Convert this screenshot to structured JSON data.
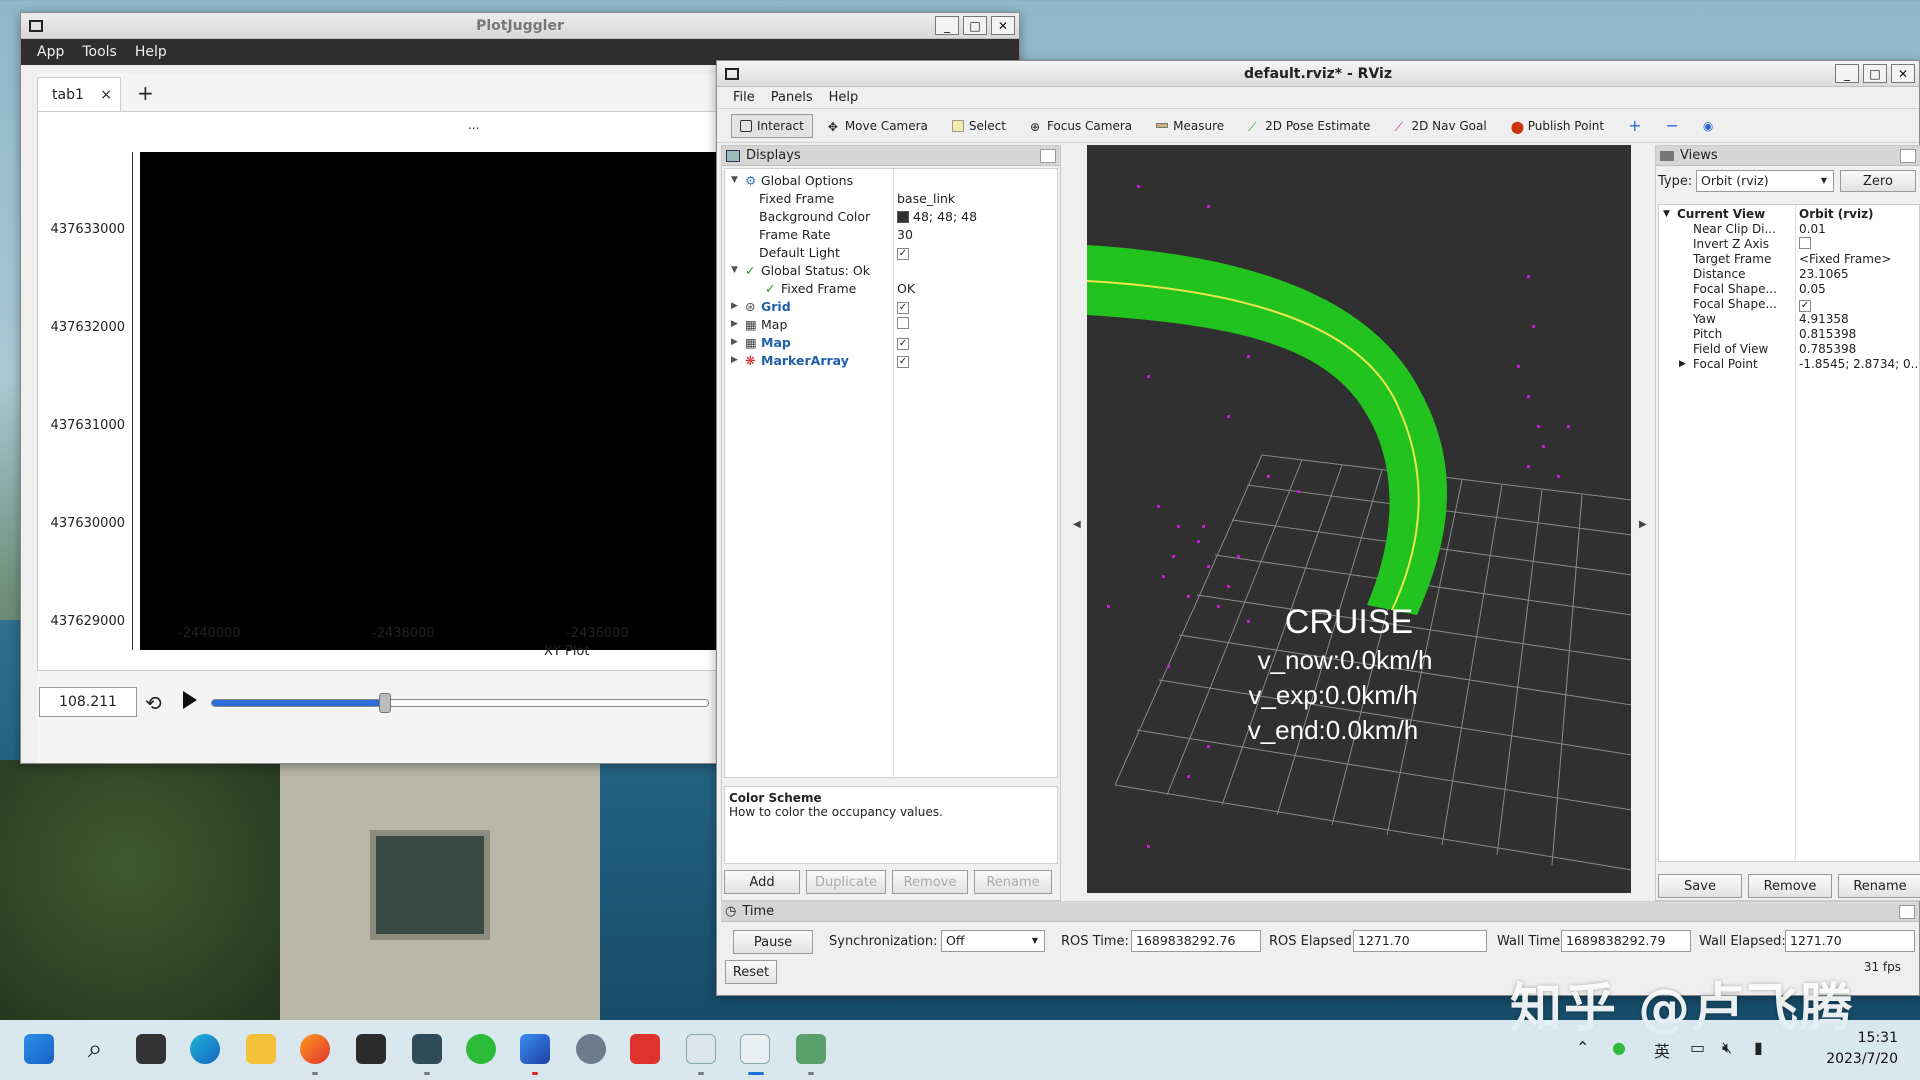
{
  "plotjuggler": {
    "title": "PlotJuggler",
    "menu": [
      "App",
      "Tools",
      "Help"
    ],
    "tab_label": "tab1",
    "tab_close": "×",
    "add_tab": "+",
    "plot_dots": "...",
    "y_ticks": [
      "437633000",
      "437632000",
      "437631000",
      "437630000",
      "437629000"
    ],
    "x_ticks": [
      "-2440000",
      "-2438000",
      "-2436000"
    ],
    "x_label": "XY Plot",
    "time_value": "108.211",
    "slider_fraction": 0.35
  },
  "rviz": {
    "title": "default.rviz* - RViz",
    "menu": [
      "File",
      "Panels",
      "Help"
    ],
    "tools": [
      "Interact",
      "Move Camera",
      "Select",
      "Focus Camera",
      "Measure",
      "2D Pose Estimate",
      "2D Nav Goal",
      "Publish Point"
    ],
    "displays": {
      "header": "Displays",
      "rows": {
        "global_options": "Global Options",
        "fixed_frame_label": "Fixed Frame",
        "fixed_frame_value": "base_link",
        "bg_color_label": "Background Color",
        "bg_color_value": "48; 48; 48",
        "frame_rate_label": "Frame Rate",
        "frame_rate_value": "30",
        "default_light_label": "Default Light",
        "global_status": "Global Status: Ok",
        "status_fixed_frame": "Fixed Frame",
        "status_fixed_frame_value": "OK",
        "grid": "Grid",
        "map1": "Map",
        "map2": "Map",
        "marker_array": "MarkerArray"
      },
      "desc_title": "Color Scheme",
      "desc_text": "How to color the occupancy values.",
      "buttons": [
        "Add",
        "Duplicate",
        "Remove",
        "Rename"
      ]
    },
    "overlay": {
      "line1": "CRUISE",
      "line2": "v_now:0.0km/h",
      "line3": "v_exp:0.0km/h",
      "line4": "v_end:0.0km/h"
    },
    "views": {
      "header": "Views",
      "type_label": "Type:",
      "type_value": "Orbit (rviz)",
      "zero_button": "Zero",
      "current_view": "Current View",
      "current_view_value": "Orbit (rviz)",
      "props": [
        {
          "k": "Near Clip Di...",
          "v": "0.01"
        },
        {
          "k": "Invert Z Axis",
          "v": ""
        },
        {
          "k": "Target Frame",
          "v": "<Fixed Frame>"
        },
        {
          "k": "Distance",
          "v": "23.1065"
        },
        {
          "k": "Focal Shape...",
          "v": "0.05"
        },
        {
          "k": "Focal Shape...",
          "v": ""
        },
        {
          "k": "Yaw",
          "v": "4.91358"
        },
        {
          "k": "Pitch",
          "v": "0.815398"
        },
        {
          "k": "Field of View",
          "v": "0.785398"
        },
        {
          "k": "Focal Point",
          "v": "-1.8545; 2.8734; 0...."
        }
      ],
      "buttons": [
        "Save",
        "Remove",
        "Rename"
      ]
    },
    "time": {
      "header": "Time",
      "pause": "Pause",
      "sync_label": "Synchronization:",
      "sync_value": "Off",
      "ros_time_label": "ROS Time:",
      "ros_time": "1689838292.76",
      "ros_elapsed_label": "ROS Elapsed:",
      "ros_elapsed": "1271.70",
      "wall_time_label": "Wall Time:",
      "wall_time": "1689838292.79",
      "wall_elapsed_label": "Wall Elapsed:",
      "wall_elapsed": "1271.70",
      "reset": "Reset",
      "fps": "31 fps"
    }
  },
  "taskbar": {
    "time": "15:31",
    "date": "2023/7/20",
    "ime": "英"
  },
  "watermark": "知乎 @卢飞腾"
}
